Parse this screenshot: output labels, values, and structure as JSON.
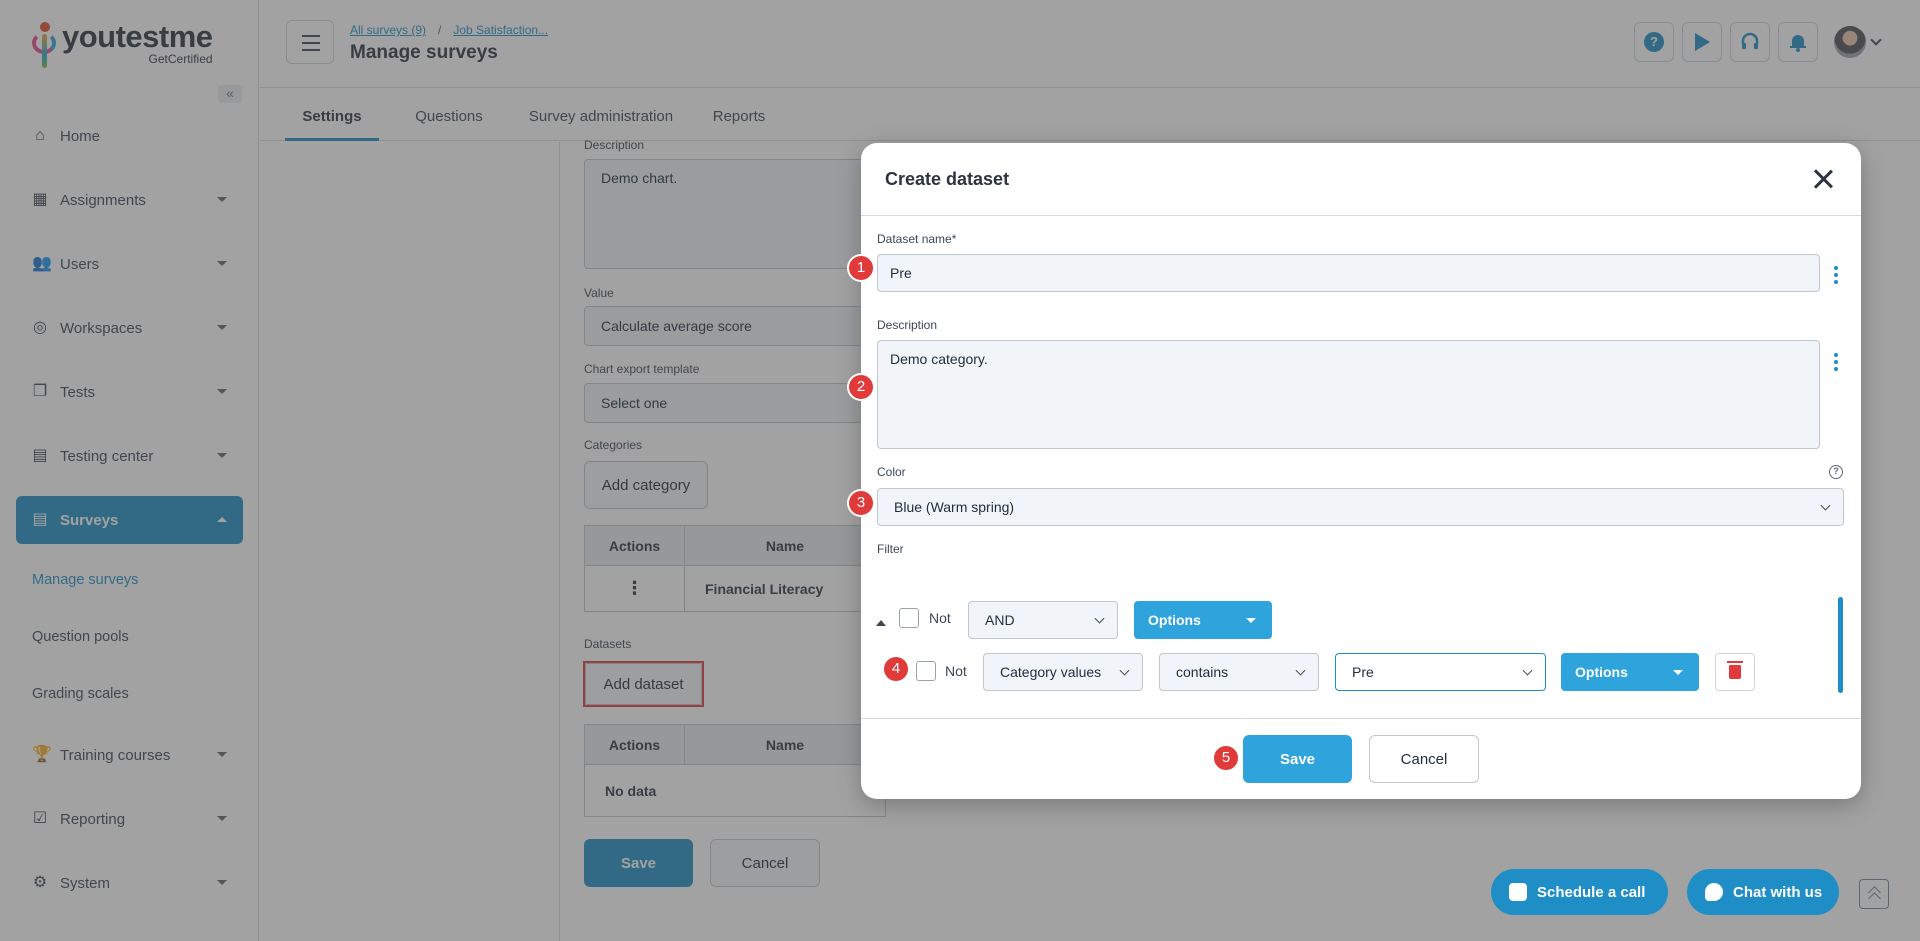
{
  "app": {
    "brand_name": "youtestme",
    "brand_sub": "GetCertified"
  },
  "sidebar": {
    "items": [
      {
        "label": "Home",
        "icon": "home-icon"
      },
      {
        "label": "Assignments",
        "icon": "assignments-icon"
      },
      {
        "label": "Users",
        "icon": "users-icon"
      },
      {
        "label": "Workspaces",
        "icon": "globe-icon"
      },
      {
        "label": "Tests",
        "icon": "tests-icon"
      },
      {
        "label": "Testing center",
        "icon": "calendar-icon"
      },
      {
        "label": "Surveys",
        "icon": "surveys-icon"
      }
    ],
    "sub_items": [
      "Manage surveys",
      "Question pools",
      "Grading scales"
    ],
    "bottom_items": [
      {
        "label": "Training courses",
        "icon": "trophy-icon"
      },
      {
        "label": "Reporting",
        "icon": "reporting-icon"
      },
      {
        "label": "System",
        "icon": "gear-icon"
      }
    ]
  },
  "header": {
    "breadcrumb_1": "All surveys (9)",
    "breadcrumb_sep": "/",
    "breadcrumb_2": "Job Satisfaction...",
    "title": "Manage surveys",
    "help_glyph": "?"
  },
  "tabs": [
    "Settings",
    "Questions",
    "Survey administration",
    "Reports"
  ],
  "background_form": {
    "description_label": "Description",
    "description_value": "Demo chart.",
    "value_label": "Value",
    "value_value": "Calculate average score",
    "export_label": "Chart export template",
    "export_value": "Select one",
    "categories_label": "Categories",
    "add_category": "Add category",
    "cat_table_headers": [
      "Actions",
      "Name"
    ],
    "cat_row_name": "Financial Literacy",
    "datasets_label": "Datasets",
    "add_dataset": "Add dataset",
    "ds_table_headers": [
      "Actions",
      "Name"
    ],
    "ds_empty": "No data",
    "save": "Save",
    "cancel": "Cancel"
  },
  "modal": {
    "title": "Create dataset",
    "dataset_name_label": "Dataset name*",
    "dataset_name_value": "Pre",
    "description_label": "Description",
    "description_value": "Demo category.",
    "color_label": "Color",
    "color_value": "Blue (Warm spring)",
    "filter_label": "Filter",
    "group": {
      "not_label": "Not",
      "operator": "AND",
      "options_label": "Options"
    },
    "rule": {
      "not_label": "Not",
      "field": "Category values",
      "operator": "contains",
      "value": "Pre",
      "options_label": "Options"
    },
    "save": "Save",
    "cancel": "Cancel",
    "callouts": [
      "1",
      "2",
      "3",
      "4",
      "5"
    ]
  },
  "floating": {
    "schedule": "Schedule a call",
    "chat": "Chat with us"
  }
}
